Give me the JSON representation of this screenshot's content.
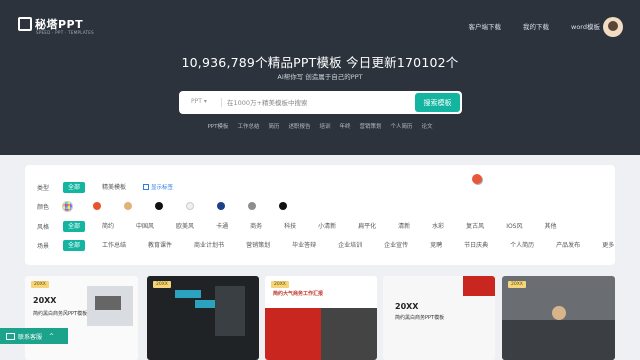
{
  "brand": {
    "logo_text": "秘塔PPT",
    "logo_sub": "SPEED · PPT · TEMPLATES"
  },
  "topnav": [
    "客户端下载",
    "我的下载",
    "word模板"
  ],
  "hero": {
    "headline": "10,936,789个精品PPT模板  今日更新170102个",
    "subline": "AI帮你写  创造属于自己的PPT"
  },
  "search": {
    "type_label": "PPT",
    "placeholder": "在1000万+精美模板中搜索",
    "button_label": "搜索模板"
  },
  "hotwords": [
    "PPT模板",
    "工作总结",
    "简历",
    "述职报告",
    "培训",
    "年终",
    "营销策划",
    "个人简历",
    "论文"
  ],
  "filters": {
    "row1": {
      "label": "类型",
      "items": [
        "全部",
        "精美模板"
      ],
      "link": "显示标签"
    },
    "row2": {
      "label": "颜色",
      "colors": [
        "#e6532c",
        "#e0b27c",
        "#111111",
        "#f0f0f0",
        "#1e3f8a",
        "#8e8e8e",
        "#111111"
      ]
    },
    "row3": {
      "label": "风格",
      "items": [
        "全部",
        "简约",
        "中国风",
        "欧美风",
        "卡通",
        "商务",
        "科技",
        "小清新",
        "扁平化",
        "清新",
        "水彩",
        "复古风",
        "IOS风",
        "其他"
      ]
    },
    "row4": {
      "label": "场景",
      "items": [
        "全部",
        "工作总结",
        "教育课件",
        "商业计划书",
        "营销策划",
        "毕业答辩",
        "企业培训",
        "企业宣传",
        "竞聘",
        "节日庆典",
        "个人简历",
        "产品发布",
        "更多"
      ]
    }
  },
  "cards": [
    {
      "badge": "20XX",
      "title": "20XX",
      "line": "简约黑白商务风PPT模板"
    },
    {
      "badge": "20XX",
      "title": "",
      "line": ""
    },
    {
      "badge": "20XX",
      "title": "",
      "line": "简约大气商务工作汇报"
    },
    {
      "badge": "",
      "title": "20XX",
      "line": "简约黑白商务PPT模板"
    },
    {
      "badge": "20XX",
      "title": "",
      "line": ""
    }
  ],
  "help": {
    "label": "联系客服"
  }
}
